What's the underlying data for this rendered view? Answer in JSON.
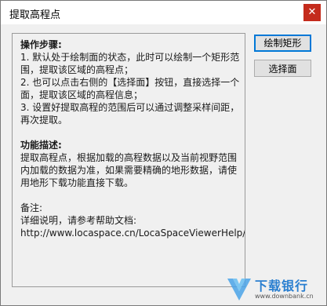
{
  "window": {
    "title": "提取高程点",
    "close_glyph": "✕"
  },
  "content": {
    "steps_heading": "操作步骤:",
    "steps": [
      "1. 默认处于绘制面的状态，此时可以绘制一个矩形范围，提取该区域的高程点；",
      "2. 也可以点击右侧的【选择面】按钮，直接选择一个面，提取该区域的高程信息；",
      "3. 设置好提取高程的范围后可以通过调整采样间距，再次提取。"
    ],
    "desc_heading": "功能描述:",
    "desc_text": "提取高程点，根据加载的高程数据以及当前视野范围内加载的数据为准，如果需要精确的地形数据，请使用地形下载功能直接下载。",
    "note_heading": "备注:",
    "note_line1": "详细说明，请参考帮助文档:",
    "note_url": "http://www.locaspace.cn/LocaSpaceViewerHelp/"
  },
  "buttons": {
    "draw_rect": "绘制矩形",
    "select_face": "选择面"
  },
  "watermark": {
    "brand": "下载银行",
    "url": "www.downbank.cn"
  },
  "colors": {
    "accent": "#0078d7",
    "close": "#c42b1c",
    "watermark": "#2a7fd0"
  }
}
